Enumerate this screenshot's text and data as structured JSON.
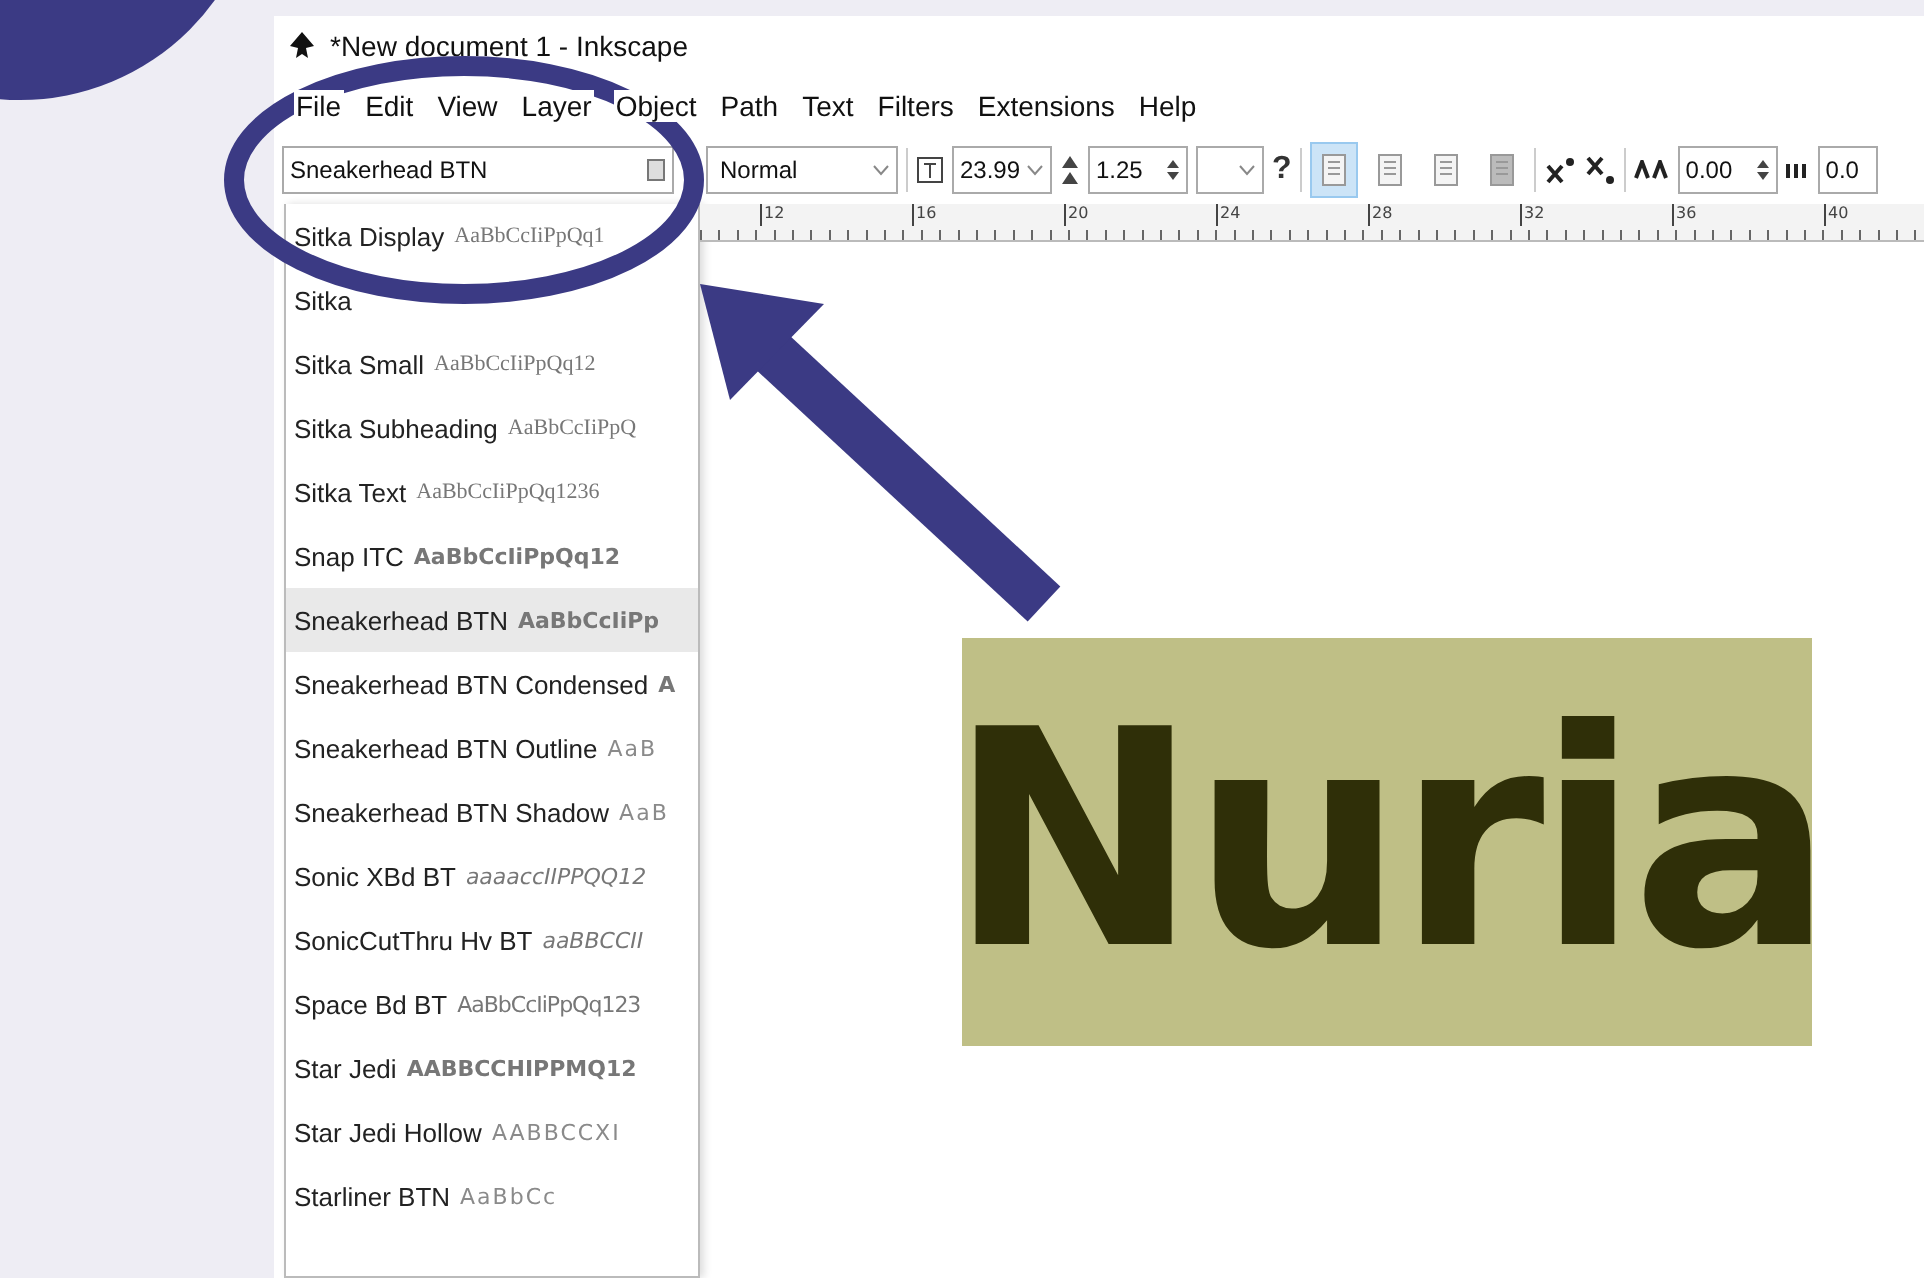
{
  "window": {
    "title": "*New document 1 - Inkscape"
  },
  "menu": [
    {
      "label": "File"
    },
    {
      "label": "Edit"
    },
    {
      "label": "View"
    },
    {
      "label": "Layer"
    },
    {
      "label": "Object"
    },
    {
      "label": "Path"
    },
    {
      "label": "Text"
    },
    {
      "label": "Filters"
    },
    {
      "label": "Extensions"
    },
    {
      "label": "Help"
    }
  ],
  "toolbar": {
    "font_family": "Sneakerhead BTN",
    "font_style": "Normal",
    "font_size": "23.99",
    "line_spacing": "1.25",
    "help": "?",
    "alignment": [
      {
        "selected": true
      },
      {
        "selected": false
      },
      {
        "selected": false
      },
      {
        "selected": false
      }
    ],
    "letter_spacing": "0.00",
    "word_spacing": "0.0"
  },
  "ruler": [
    "12",
    "16",
    "20",
    "24",
    "28",
    "32",
    "36",
    "40"
  ],
  "font_list": [
    {
      "name": "Sitka Display",
      "sample": "AaBbCcIiPpQq1",
      "kind": "serif",
      "selected": false
    },
    {
      "name": "Sitka",
      "selected": false
    },
    {
      "name": "Sitka Small",
      "sample": "AaBbCcIiPpQq12",
      "kind": "serif",
      "selected": false
    },
    {
      "name": "Sitka Subheading",
      "sample": "AaBbCcIiPpQ",
      "kind": "serif",
      "selected": false
    },
    {
      "name": "Sitka Text",
      "sample": "AaBbCcIiPpQq1236",
      "kind": "serif",
      "selected": false
    },
    {
      "name": "Snap ITC",
      "sample": "AaBbCcIiPpQq12",
      "kind": "heavy",
      "selected": false
    },
    {
      "name": "Sneakerhead BTN",
      "sample": "AaBbCcIiPp",
      "kind": "heavy",
      "selected": true
    },
    {
      "name": "Sneakerhead BTN Condensed",
      "sample": "A",
      "kind": "heavy",
      "selected": false
    },
    {
      "name": "Sneakerhead BTN Outline",
      "sample": "AaB",
      "kind": "outline",
      "selected": false
    },
    {
      "name": "Sneakerhead BTN Shadow",
      "sample": "AaB",
      "kind": "outline",
      "selected": false
    },
    {
      "name": "Sonic XBd BT",
      "sample": "aaaaccIIPPQQ12",
      "kind": "italic",
      "selected": false
    },
    {
      "name": "SonicCutThru Hv BT",
      "sample": "aaBBCCII",
      "kind": "italic",
      "selected": false
    },
    {
      "name": "Space Bd BT",
      "sample": "AaBbCcIiPpQq123",
      "kind": "thin",
      "selected": false
    },
    {
      "name": "Star Jedi",
      "sample": "AABBCCHIPPMQ12",
      "kind": "heavy",
      "selected": false
    },
    {
      "name": "Star Jedi Hollow",
      "sample": "AABBCCXI",
      "kind": "outline",
      "selected": false
    },
    {
      "name": "Starliner BTN",
      "sample": "AaBbCc",
      "kind": "outline",
      "selected": false
    }
  ],
  "canvas": {
    "text": "Nuria"
  }
}
